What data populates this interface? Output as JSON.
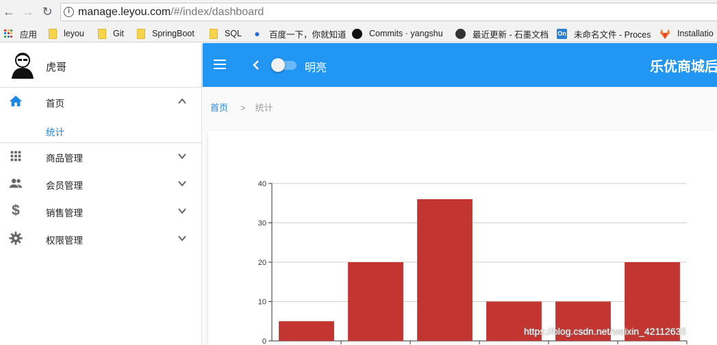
{
  "browser": {
    "url_host": "manage.leyou.com",
    "url_path": "/#/index/dashboard",
    "bookmarks": [
      {
        "label": "应用",
        "icon": "apps-grid-icon"
      },
      {
        "label": "leyou",
        "icon": "folder-icon"
      },
      {
        "label": "Git",
        "icon": "folder-icon"
      },
      {
        "label": "SpringBoot",
        "icon": "folder-icon"
      },
      {
        "label": "SQL",
        "icon": "folder-icon"
      },
      {
        "label": "百度一下，你就知道",
        "icon": "baidu-paw-icon"
      },
      {
        "label": "Commits · yangshu",
        "icon": "github-icon"
      },
      {
        "label": "最近更新 - 石墨文档",
        "icon": "shimo-icon"
      },
      {
        "label": "未命名文件 - Proces",
        "icon": "processon-icon"
      },
      {
        "label": "Installatio",
        "icon": "gitlab-icon"
      }
    ]
  },
  "sidebar": {
    "user_name": "虎哥",
    "menu": [
      {
        "label": "首页",
        "icon": "home-icon",
        "expanded": true
      },
      {
        "label": "商品管理",
        "icon": "apps-grid-icon",
        "expanded": false
      },
      {
        "label": "会员管理",
        "icon": "people-icon",
        "expanded": false
      },
      {
        "label": "销售管理",
        "icon": "dollar-icon",
        "expanded": false
      },
      {
        "label": "权限管理",
        "icon": "gear-icon",
        "expanded": false
      }
    ],
    "submenu_active": "统计"
  },
  "appbar": {
    "theme_label": "明亮",
    "title": "乐优商城后",
    "color": "#2196f3"
  },
  "breadcrumb": {
    "home": "首页",
    "separator": ">",
    "current": "统计"
  },
  "chart_data": {
    "type": "bar",
    "categories": [
      "",
      "",
      "",
      "",
      "",
      ""
    ],
    "values": [
      5,
      20,
      36,
      10,
      10,
      20
    ],
    "ylim": [
      0,
      40
    ],
    "yticks": [
      "0",
      "10",
      "20",
      "30",
      "40"
    ],
    "grid": true,
    "bar_color": "#c23531"
  },
  "watermark": "https://blog.csdn.net/weixin_42112635"
}
